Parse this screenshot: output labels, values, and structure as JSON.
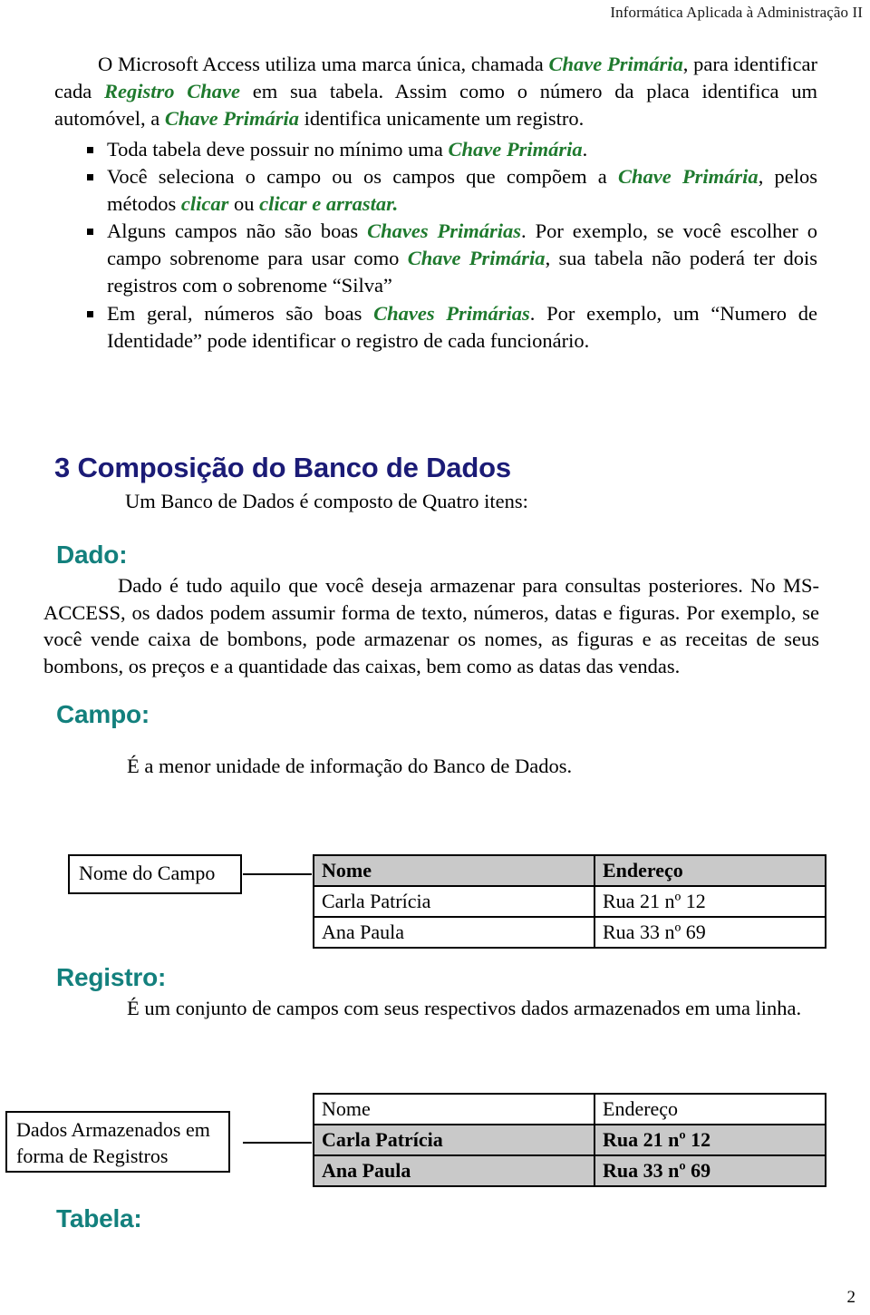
{
  "header": {
    "running_title": "Informática Aplicada à Administração II"
  },
  "intro": {
    "p1_a": "O Microsoft Access utiliza uma marca única, chamada ",
    "p1_term1": "Chave Primária",
    "p1_b": ", para identificar cada ",
    "p1_term2": "Registro Chave",
    "p1_c": " em sua tabela. Assim como o número da placa identifica um automóvel, a ",
    "p1_term3": "Chave Primária",
    "p1_d": " identifica unicamente um registro."
  },
  "bullets": [
    {
      "a": "Toda tabela deve possuir no mínimo uma ",
      "term1": "Chave Primária",
      "b": "."
    },
    {
      "a": "Você seleciona o campo ou os campos que compõem a ",
      "term1": "Chave Primária",
      "b": ", pelos métodos ",
      "term2": "clicar",
      "c": " ou ",
      "term3": "clicar e arrastar.",
      "d": ""
    },
    {
      "a": "Alguns campos não são boas ",
      "term1": "Chaves Primárias",
      "b": ". Por exemplo, se você escolher o campo sobrenome para usar como ",
      "term2": "Chave Primária",
      "c": ", sua tabela não poderá ter dois registros com o sobrenome “Silva”"
    },
    {
      "a": "Em geral, números são boas ",
      "term1": "Chaves Primárias",
      "b": ". Por exemplo, um “Numero de Identidade” pode identificar o registro de cada funcionário."
    }
  ],
  "section3": {
    "heading": "3 Composição do Banco de Dados",
    "lead": "Um Banco de Dados é composto de Quatro itens:"
  },
  "dado": {
    "heading": "Dado:",
    "text": "Dado é tudo aquilo que você deseja armazenar para consultas posteriores. No MS-ACCESS, os dados podem assumir forma de texto, números, datas e figuras. Por exemplo, se você vende caixa de bombons, pode armazenar os nomes, as figuras e as receitas de seus bombons, os preços e a quantidade das caixas, bem como as datas das vendas."
  },
  "campo": {
    "heading": "Campo:",
    "text": "É a menor unidade de informação do Banco de Dados."
  },
  "table_fields": {
    "callout_label": "Nome do Campo",
    "columns": [
      "Nome",
      "Endereço"
    ],
    "rows": [
      [
        "Carla Patrícia",
        "Rua 21 nº 12"
      ],
      [
        "Ana Paula",
        "Rua 33 nº 69"
      ]
    ]
  },
  "registro": {
    "heading": "Registro:",
    "text": "É um conjunto de campos com seus respectivos dados armazenados em uma linha."
  },
  "table_records": {
    "callout_label_line1": "Dados Armazenados em",
    "callout_label_line2": "forma de Registros",
    "columns": [
      "Nome",
      "Endereço"
    ],
    "rows": [
      [
        "Carla Patrícia",
        "Rua 21 nº 12"
      ],
      [
        "Ana Paula",
        "Rua 33 nº 69"
      ]
    ]
  },
  "tabela": {
    "heading": "Tabela:"
  },
  "footer": {
    "page_number": "2"
  },
  "colors": {
    "accent_green": "#1f7a2e",
    "heading_navy": "#1b1b76",
    "heading_teal": "#13807d",
    "table_gray": "#c9c9c9"
  }
}
